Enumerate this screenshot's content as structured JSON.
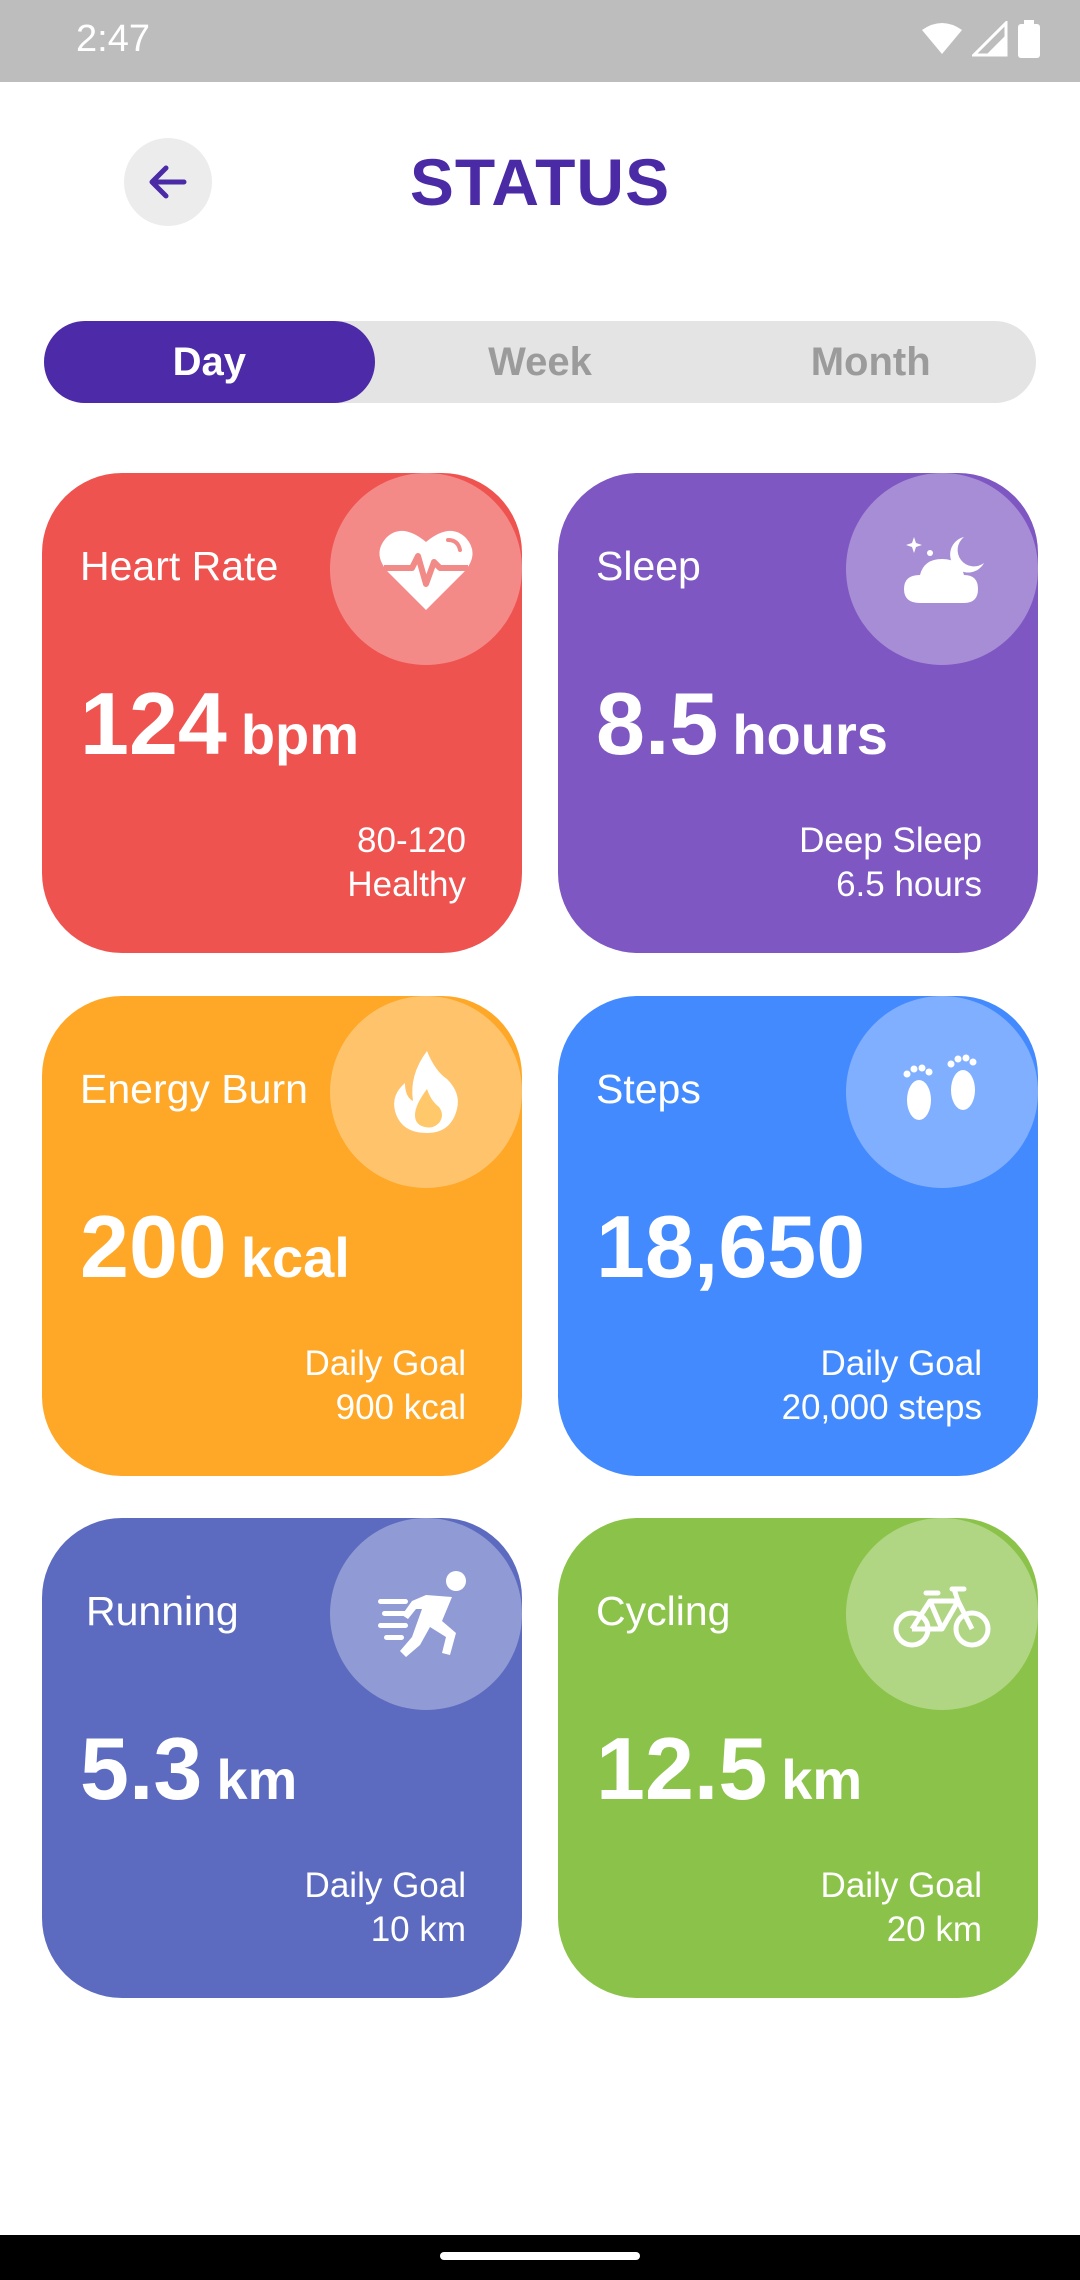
{
  "status_bar": {
    "time": "2:47"
  },
  "header": {
    "title": "STATUS"
  },
  "tabs": [
    {
      "label": "Day",
      "active": true
    },
    {
      "label": "Week",
      "active": false
    },
    {
      "label": "Month",
      "active": false
    }
  ],
  "cards": [
    {
      "label": "Heart Rate",
      "value": "124",
      "unit": "bpm",
      "note1": "80-120",
      "note2": "Healthy",
      "color": "#ef5350",
      "icon": "heart-rate-icon"
    },
    {
      "label": "Sleep",
      "value": "8.5",
      "unit": "hours",
      "note1": "Deep Sleep",
      "note2": "6.5 hours",
      "color": "#7e57c2",
      "icon": "moon-cloud-icon"
    },
    {
      "label": "Energy Burn",
      "value": "200",
      "unit": "kcal",
      "note1": "Daily Goal",
      "note2": "900 kcal",
      "color": "#ffa726",
      "icon": "flame-icon"
    },
    {
      "label": "Steps",
      "value": "18,650",
      "unit": "",
      "note1": "Daily Goal",
      "note2": "20,000 steps",
      "color": "#448aff",
      "icon": "footprints-icon"
    },
    {
      "label": "Running",
      "value": "5.3",
      "unit": "km",
      "note1": "Daily Goal",
      "note2": "10 km",
      "color": "#5c6bc0",
      "icon": "runner-icon"
    },
    {
      "label": "Cycling",
      "value": "12.5",
      "unit": "km",
      "note1": "Daily Goal",
      "note2": "20 km",
      "color": "#8bc34a",
      "icon": "bicycle-icon"
    }
  ]
}
